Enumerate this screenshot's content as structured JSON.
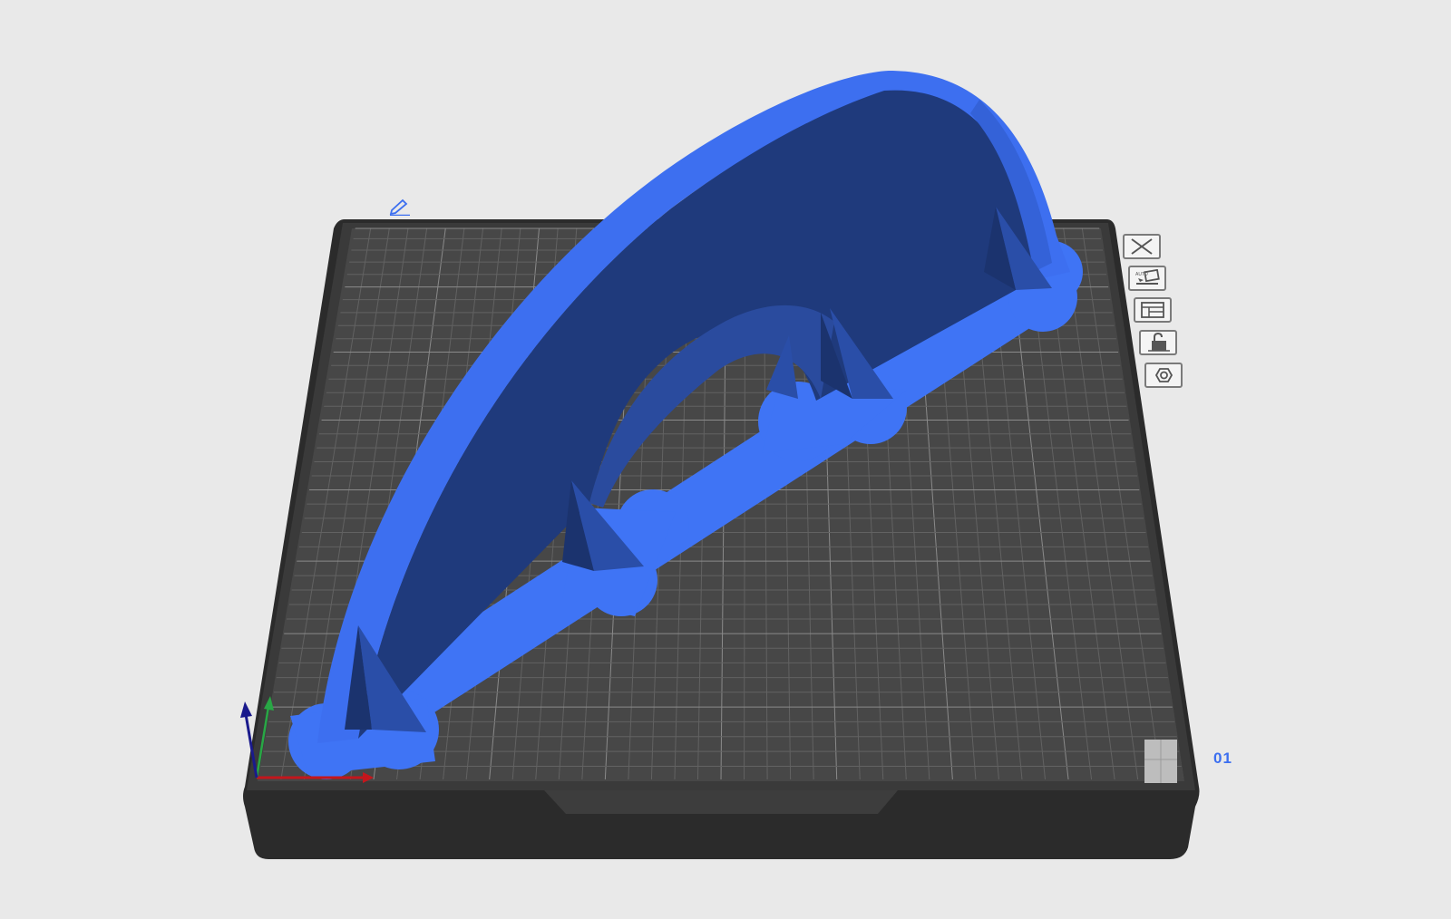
{
  "plate": {
    "index_label": "01"
  },
  "tools": [
    {
      "name": "delete-plate-button",
      "icon": "close-x-icon"
    },
    {
      "name": "auto-orient-button",
      "icon": "auto-orient-icon"
    },
    {
      "name": "arrange-button",
      "icon": "arrange-layout-icon"
    },
    {
      "name": "lock-plate-button",
      "icon": "unlock-icon"
    },
    {
      "name": "plate-settings-button",
      "icon": "hex-nut-settings-icon"
    }
  ],
  "colors": {
    "background": "#e9e9e9",
    "model_face": "#1f3a7a",
    "model_highlight": "#3b72f2",
    "plate_grid": "#4a4a4a",
    "plate_body": "#2c2c2c",
    "accent": "#3c6ff0"
  }
}
